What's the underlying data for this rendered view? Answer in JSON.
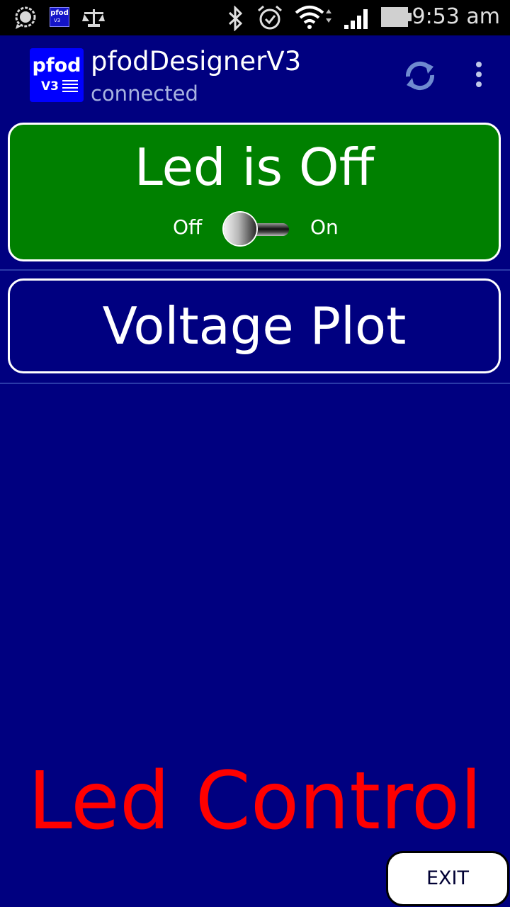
{
  "status_bar": {
    "time": "9:53 am",
    "notification_icons": [
      "chat-bubble-icon",
      "pfod-app-icon",
      "scales-icon"
    ],
    "system_icons": [
      "bluetooth-icon",
      "alarm-icon",
      "wifi-icon",
      "signal-icon",
      "battery-icon"
    ],
    "mini_logo_top": "pfod",
    "mini_logo_bottom": "V3"
  },
  "action_bar": {
    "logo_top": "pfod",
    "logo_bottom": "V3",
    "title": "pfodDesignerV3",
    "subtitle": "connected",
    "icons": [
      "refresh-icon",
      "overflow-menu-icon"
    ]
  },
  "menu": {
    "led_button": {
      "label": "Led is Off",
      "switch_off_label": "Off",
      "switch_on_label": "On",
      "state": "off",
      "color": "#008000"
    },
    "voltage_button": {
      "label": "Voltage Plot",
      "color": "#000080"
    }
  },
  "footer": {
    "title": "Led Control",
    "title_color": "#ff0000",
    "exit_label": "EXIT"
  },
  "colors": {
    "background": "#000080",
    "status_bar": "#000000"
  }
}
